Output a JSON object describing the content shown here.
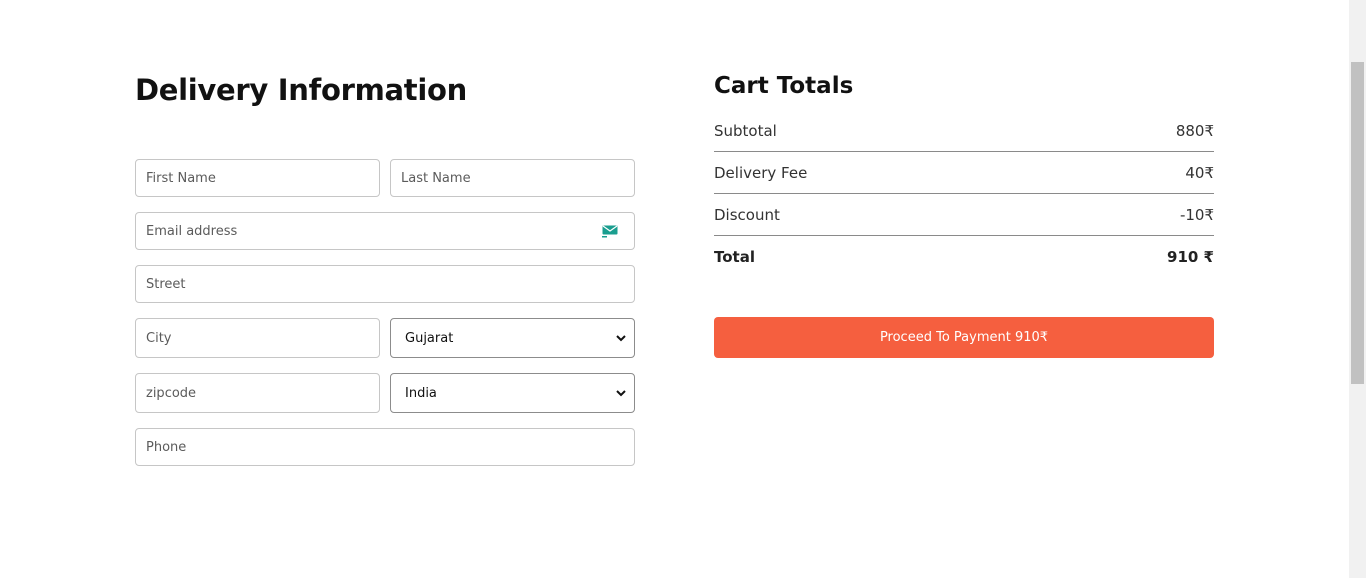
{
  "delivery": {
    "title": "Delivery Information",
    "first_name_placeholder": "First Name",
    "last_name_placeholder": "Last Name",
    "email_placeholder": "Email address",
    "street_placeholder": "Street",
    "city_placeholder": "City",
    "state_selected": "Gujarat",
    "zipcode_placeholder": "zipcode",
    "country_selected": "India",
    "phone_placeholder": "Phone"
  },
  "cart": {
    "title": "Cart Totals",
    "rows": [
      {
        "label": "Subtotal",
        "value": "880₹"
      },
      {
        "label": "Delivery Fee",
        "value": "40₹"
      },
      {
        "label": "Discount",
        "value": "-10₹"
      },
      {
        "label": "Total",
        "value": "910 ₹"
      }
    ],
    "pay_button_label": "Proceed To Payment 910₹"
  },
  "colors": {
    "accent": "#f55f3f",
    "email_icon": "#1a9e8f"
  },
  "icons": {
    "email": "envelope-icon",
    "select": "chevron-down-icon"
  }
}
